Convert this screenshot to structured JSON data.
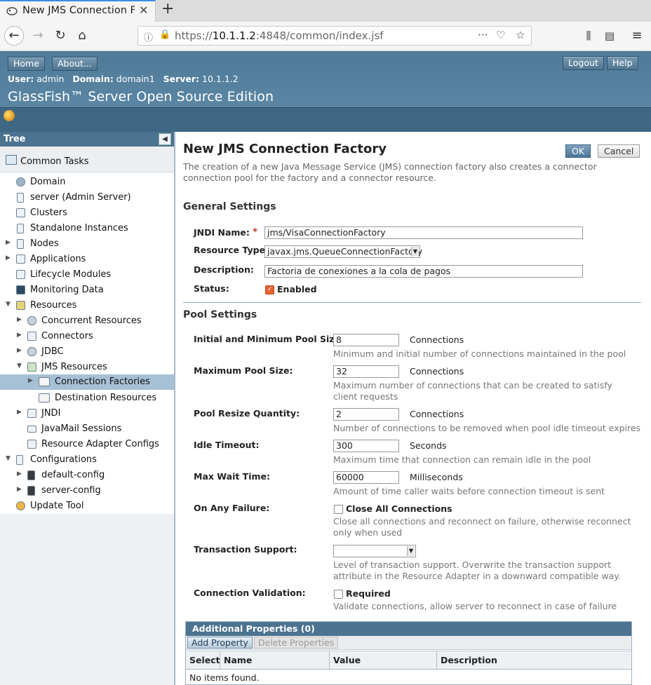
{
  "browser": {
    "tab_title": "New JMS Connection Fac",
    "url_prefix": "https://",
    "url_host": "10.1.1.2",
    "url_rest": ":4848/common/index.jsf"
  },
  "header": {
    "home_label": "Home",
    "about_label": "About...",
    "logout_label": "Logout",
    "help_label": "Help",
    "user_key": "User:",
    "user_value": "admin",
    "domain_key": "Domain:",
    "domain_value": "domain1",
    "server_key": "Server:",
    "server_value": "10.1.1.2",
    "brand": "GlassFish™ Server Open Source Edition"
  },
  "tree": {
    "title": "Tree",
    "common_tasks": "Common Tasks",
    "nodes": [
      {
        "label": "Domain"
      },
      {
        "label": "server (Admin Server)"
      },
      {
        "label": "Clusters"
      },
      {
        "label": "Standalone Instances"
      },
      {
        "label": "Nodes"
      },
      {
        "label": "Applications"
      },
      {
        "label": "Lifecycle Modules"
      },
      {
        "label": "Monitoring Data"
      },
      {
        "label": "Resources"
      },
      {
        "label": "Concurrent Resources"
      },
      {
        "label": "Connectors"
      },
      {
        "label": "JDBC"
      },
      {
        "label": "JMS Resources"
      },
      {
        "label": "Connection Factories"
      },
      {
        "label": "Destination Resources"
      },
      {
        "label": "JNDI"
      },
      {
        "label": "JavaMail Sessions"
      },
      {
        "label": "Resource Adapter Configs"
      },
      {
        "label": "Configurations"
      },
      {
        "label": "default-config"
      },
      {
        "label": "server-config"
      },
      {
        "label": "Update Tool"
      }
    ]
  },
  "page": {
    "title": "New JMS Connection Factory",
    "ok_label": "OK",
    "cancel_label": "Cancel",
    "description": "The creation of a new Java Message Service (JMS) connection factory also creates a connector connection pool for the factory and a connector resource."
  },
  "general": {
    "heading": "General Settings",
    "jndi_label": "JNDI Name:",
    "jndi_required": "*",
    "jndi_value": "jms/VisaConnectionFactory",
    "rtype_label": "Resource Type:",
    "rtype_value": "javax.jms.QueueConnectionFactory",
    "desc_label": "Description:",
    "desc_value": "Factoria de conexiones a la cola de pagos",
    "status_label": "Status:",
    "status_checkbox_label": "Enabled"
  },
  "pool": {
    "heading": "Pool Settings",
    "initial_label": "Initial and Minimum Pool Size:",
    "initial_value": "8",
    "initial_unit": "Connections",
    "initial_hint": "Minimum and initial number of connections maintained in the pool",
    "max_label": "Maximum Pool Size:",
    "max_value": "32",
    "max_unit": "Connections",
    "max_hint": "Maximum number of connections that can be created to satisfy client requests",
    "resize_label": "Pool Resize Quantity:",
    "resize_value": "2",
    "resize_unit": "Connections",
    "resize_hint": "Number of connections to be removed when pool idle timeout expires",
    "idle_label": "Idle Timeout:",
    "idle_value": "300",
    "idle_unit": "Seconds",
    "idle_hint": "Maximum time that connection can remain idle in the pool",
    "wait_label": "Max Wait Time:",
    "wait_value": "60000",
    "wait_unit": "Milliseconds",
    "wait_hint": "Amount of time caller waits before connection timeout is sent",
    "failure_label": "On Any Failure:",
    "failure_checkbox_label": "Close All Connections",
    "failure_hint": "Close all connections and reconnect on failure, otherwise reconnect only when used",
    "tx_label": "Transaction Support:",
    "tx_value": "",
    "tx_hint": "Level of transaction support. Overwrite the transaction support attribute in the Resource Adapter in a downward compatible way.",
    "validation_label": "Connection Validation:",
    "validation_checkbox_label": "Required",
    "validation_hint": "Validate connections, allow server to reconnect in case of failure"
  },
  "props": {
    "title": "Additional Properties (0)",
    "add_label": "Add Property",
    "delete_label": "Delete Properties",
    "columns": [
      "Select",
      "Name",
      "Value",
      "Description"
    ],
    "empty": "No items found."
  }
}
